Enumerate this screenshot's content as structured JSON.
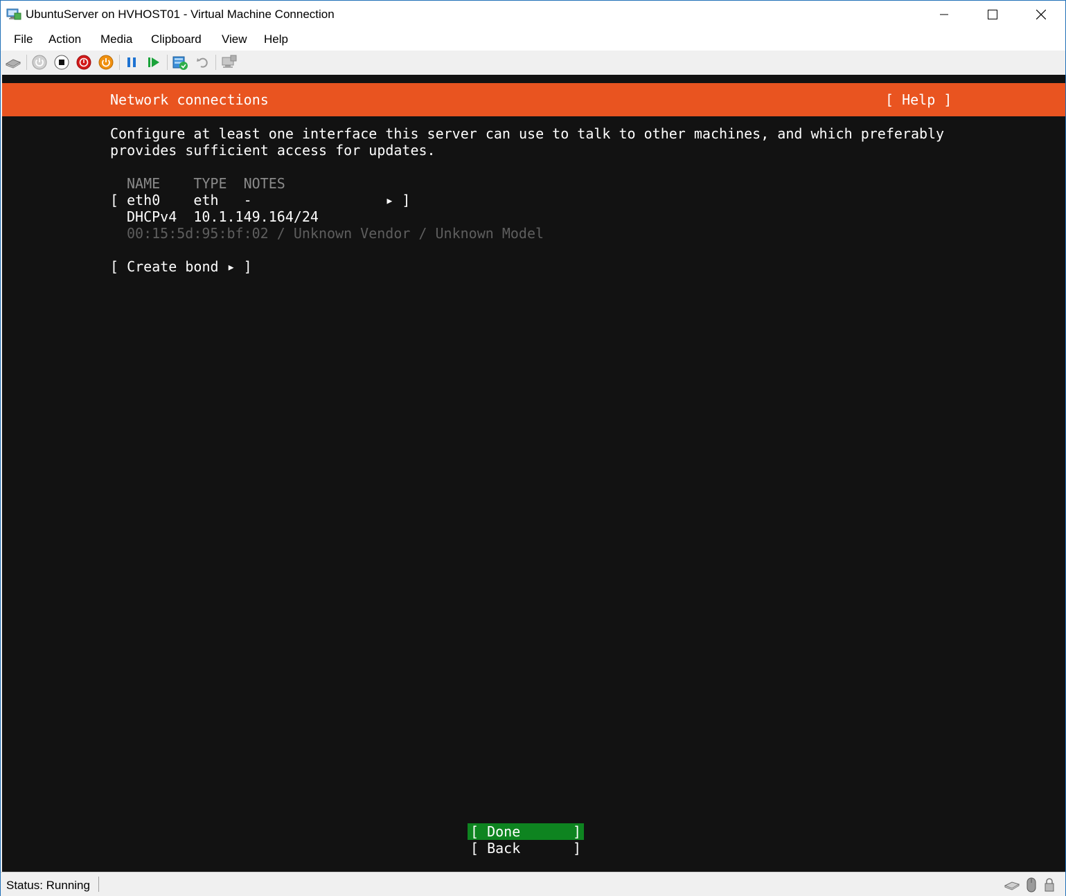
{
  "window": {
    "title": "UbuntuServer on HVHOST01 - Virtual Machine Connection"
  },
  "menu": {
    "items": [
      "File",
      "Action",
      "Media",
      "Clipboard",
      "View",
      "Help"
    ]
  },
  "toolbar": {
    "buttons": [
      {
        "icon": "ctrl-alt-del-icon"
      },
      {
        "icon": "start-icon"
      },
      {
        "icon": "turn-off-icon"
      },
      {
        "icon": "shut-down-icon"
      },
      {
        "icon": "save-icon"
      },
      {
        "icon": "pause-icon"
      },
      {
        "icon": "resume-icon"
      },
      {
        "icon": "checkpoint-icon"
      },
      {
        "icon": "revert-icon"
      },
      {
        "icon": "enhanced-session-icon"
      }
    ]
  },
  "installer": {
    "header_title": "Network connections",
    "help_label": "[ Help ]",
    "description_line1": "Configure at least one interface this server can use to talk to other machines, and which preferably",
    "description_line2": "provides sufficient access for updates.",
    "table_header": "NAME    TYPE  NOTES",
    "interface_row": "[ eth0    eth   -                ▸ ]",
    "dhcp_row": "DHCPv4  10.1.149.164/24",
    "mac_row": "00:15:5d:95:bf:02 / Unknown Vendor / Unknown Model",
    "create_bond": "[ Create bond ▸ ]",
    "done_label": "[ Done",
    "back_label": "[ Back",
    "close_bracket": "]"
  },
  "status": {
    "text": "Status: Running"
  },
  "colors": {
    "header_orange": "#e95420",
    "done_green": "#0e8420",
    "screen_bg": "#121212"
  }
}
